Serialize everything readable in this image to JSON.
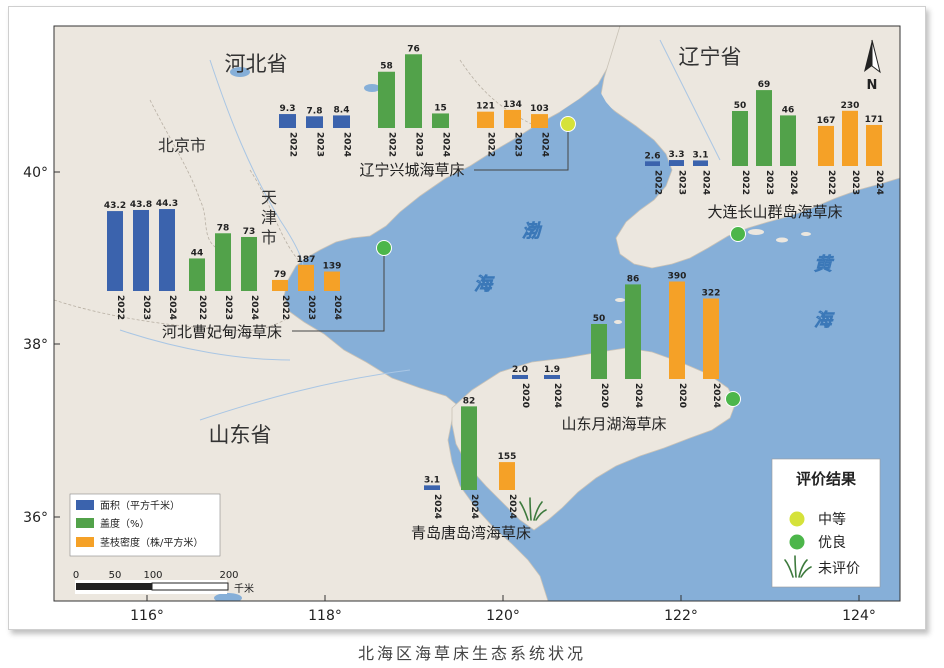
{
  "caption": "北海区海草床生态系统状况",
  "provinces": {
    "hebei": "河北省",
    "liaoning": "辽宁省",
    "shandong": "山东省"
  },
  "cities": {
    "beijing": "北京市",
    "tianjin_1": "天",
    "tianjin_2": "津",
    "tianjin_3": "市"
  },
  "seas": {
    "bo_1": "渤",
    "bo_2": "海",
    "huang_1": "黄",
    "huang_2": "海"
  },
  "axis": {
    "lat_labels": [
      "40°",
      "38°",
      "36°"
    ],
    "lon_labels": [
      "116°",
      "118°",
      "120°",
      "122°",
      "124°"
    ]
  },
  "north_arrow": "N",
  "scalebar": {
    "ticks": [
      "0",
      "50",
      "100",
      "200"
    ],
    "unit": "千米"
  },
  "legend_bars": {
    "area": "面积（平方千米）",
    "coverage": "盖度（%）",
    "density": "茎枝密度（株/平方米）"
  },
  "legend_eval": {
    "title": "评价结果",
    "medium": "中等",
    "good": "优良",
    "none": "未评价"
  },
  "colors": {
    "area": "#3b63ad",
    "coverage": "#52a24a",
    "density": "#f5a127",
    "sea": "#86afd8",
    "land": "#ece7df",
    "medium": "#d5e23a",
    "good": "#4cb64a"
  },
  "sites": [
    {
      "name": "辽宁兴城海草床",
      "status": "中等",
      "area": {
        "years": [
          "2022",
          "2023",
          "2024"
        ],
        "values": [
          9.3,
          7.8,
          8.4
        ],
        "labels": [
          "9.3",
          "7.8",
          "8.4"
        ]
      },
      "coverage": {
        "years": [
          "2022",
          "2023",
          "2024"
        ],
        "values": [
          58,
          76,
          15
        ],
        "labels": [
          "58",
          "76",
          "15"
        ]
      },
      "density": {
        "years": [
          "2022",
          "2023",
          "2024"
        ],
        "values": [
          121,
          134,
          103
        ],
        "labels": [
          "121",
          "134",
          "103"
        ]
      }
    },
    {
      "name": "大连长山群岛海草床",
      "status": "优良",
      "area": {
        "years": [
          "2022",
          "2023",
          "2024"
        ],
        "values": [
          2.6,
          3.3,
          3.1
        ],
        "labels": [
          "2.6",
          "3.3",
          "3.1"
        ]
      },
      "coverage": {
        "years": [
          "2022",
          "2023",
          "2024"
        ],
        "values": [
          50,
          69,
          46
        ],
        "labels": [
          "50",
          "69",
          "46"
        ]
      },
      "density": {
        "years": [
          "2022",
          "2023",
          "2024"
        ],
        "values": [
          167,
          230,
          171
        ],
        "labels": [
          "167",
          "230",
          "171"
        ]
      }
    },
    {
      "name": "河北曹妃甸海草床",
      "status": "优良",
      "area": {
        "years": [
          "2022",
          "2023",
          "2024"
        ],
        "values": [
          43.2,
          43.8,
          44.3
        ],
        "labels": [
          "43.2",
          "43.8",
          "44.3"
        ]
      },
      "coverage": {
        "years": [
          "2022",
          "2023",
          "2024"
        ],
        "values": [
          44,
          78,
          73
        ],
        "labels": [
          "44",
          "78",
          "73"
        ]
      },
      "density": {
        "years": [
          "2022",
          "2023",
          "2024"
        ],
        "values": [
          79,
          187,
          139
        ],
        "labels": [
          "79",
          "187",
          "139"
        ]
      }
    },
    {
      "name": "山东月湖海草床",
      "status": "优良",
      "area": {
        "years": [
          "2020",
          "2024"
        ],
        "values": [
          2.0,
          1.9
        ],
        "labels": [
          "2.0",
          "1.9"
        ]
      },
      "coverage": {
        "years": [
          "2020",
          "2024"
        ],
        "values": [
          50,
          86
        ],
        "labels": [
          "50",
          "86"
        ]
      },
      "density": {
        "years": [
          "2020",
          "2024"
        ],
        "values": [
          390,
          322
        ],
        "labels": [
          "390",
          "322"
        ]
      }
    },
    {
      "name": "青岛唐岛湾海草床",
      "status": "未评价",
      "area": {
        "years": [
          "2024"
        ],
        "values": [
          3.1
        ],
        "labels": [
          "3.1"
        ]
      },
      "coverage": {
        "years": [
          "2024"
        ],
        "values": [
          82
        ],
        "labels": [
          "82"
        ]
      },
      "density": {
        "years": [
          "2024"
        ],
        "values": [
          155
        ],
        "labels": [
          "155"
        ]
      }
    }
  ]
}
